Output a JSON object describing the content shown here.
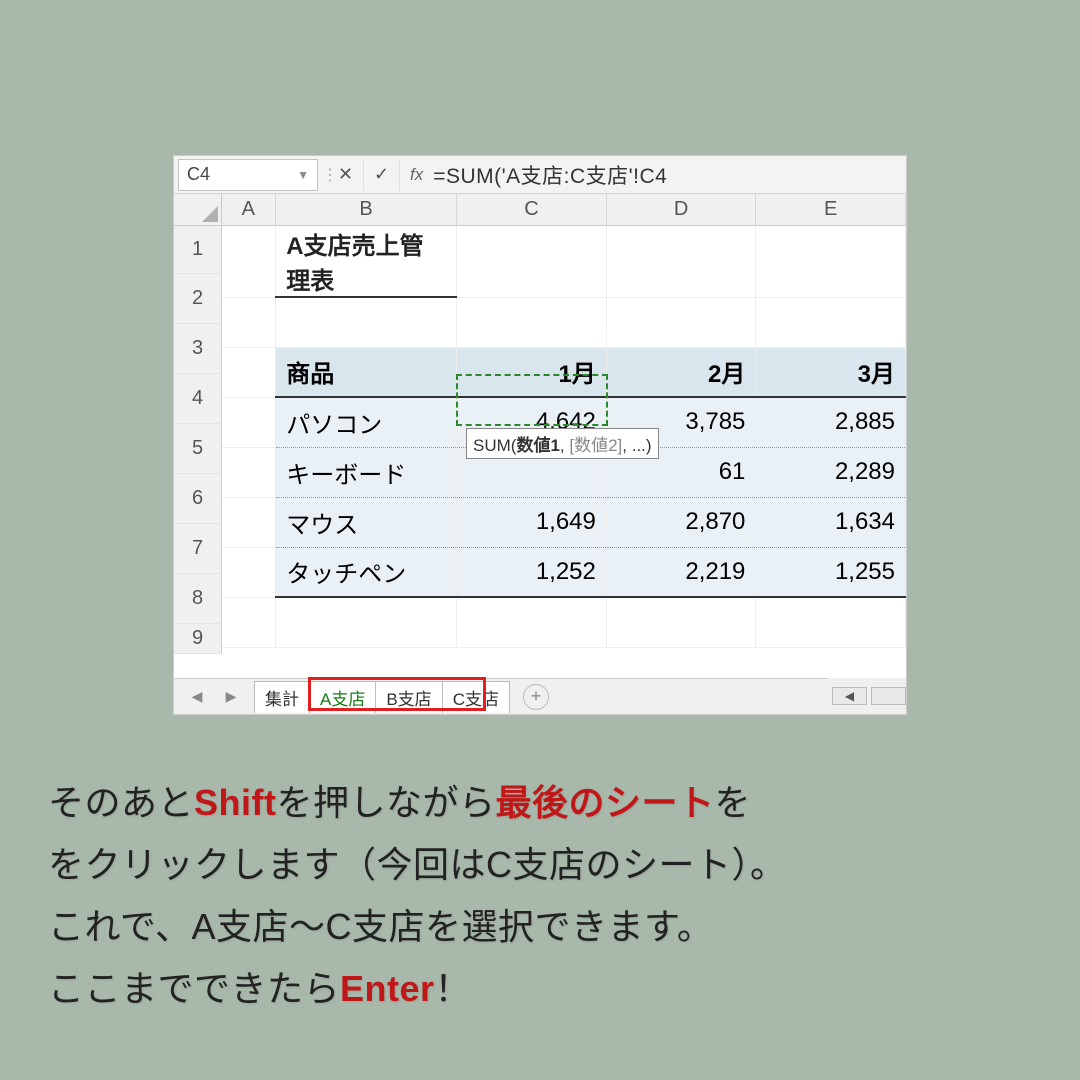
{
  "formula_bar": {
    "name_box": "C4",
    "fx_label": "fx",
    "formula": "=SUM('A支店:C支店'!C4"
  },
  "columns": [
    "A",
    "B",
    "C",
    "D",
    "E"
  ],
  "rows": [
    "1",
    "2",
    "3",
    "4",
    "5",
    "6",
    "7",
    "8",
    "9"
  ],
  "title": "A支店売上管理表",
  "headers": {
    "product": "商品",
    "m1": "1月",
    "m2": "2月",
    "m3": "3月"
  },
  "data": [
    {
      "name": "パソコン",
      "m1": "4,642",
      "m2": "3,785",
      "m3": "2,885"
    },
    {
      "name": "キーボード",
      "m1": "",
      "m2": "61",
      "m3": "2,289"
    },
    {
      "name": "マウス",
      "m1": "1,649",
      "m2": "2,870",
      "m3": "1,634"
    },
    {
      "name": "タッチペン",
      "m1": "1,252",
      "m2": "2,219",
      "m3": "1,255"
    }
  ],
  "tooltip": {
    "fn": "SUM(",
    "arg1": "数値1",
    "sep": ", ",
    "arg2": "[数値2]",
    "tail": ", ...)"
  },
  "tabs": {
    "summary": "集計",
    "a": "A支店",
    "b": "B支店",
    "c": "C支店"
  },
  "instructions": {
    "p1a": "そのあと",
    "p1b": "Shift",
    "p1c": "を押しながら",
    "p1d": "最後のシート",
    "p1e": "を",
    "p2": "をクリックします（今回はC支店のシート）。",
    "p3": "これで、A支店～C支店を選択できます。",
    "p4a": "ここまでできたら",
    "p4b": "Enter",
    "p4c": "！"
  }
}
